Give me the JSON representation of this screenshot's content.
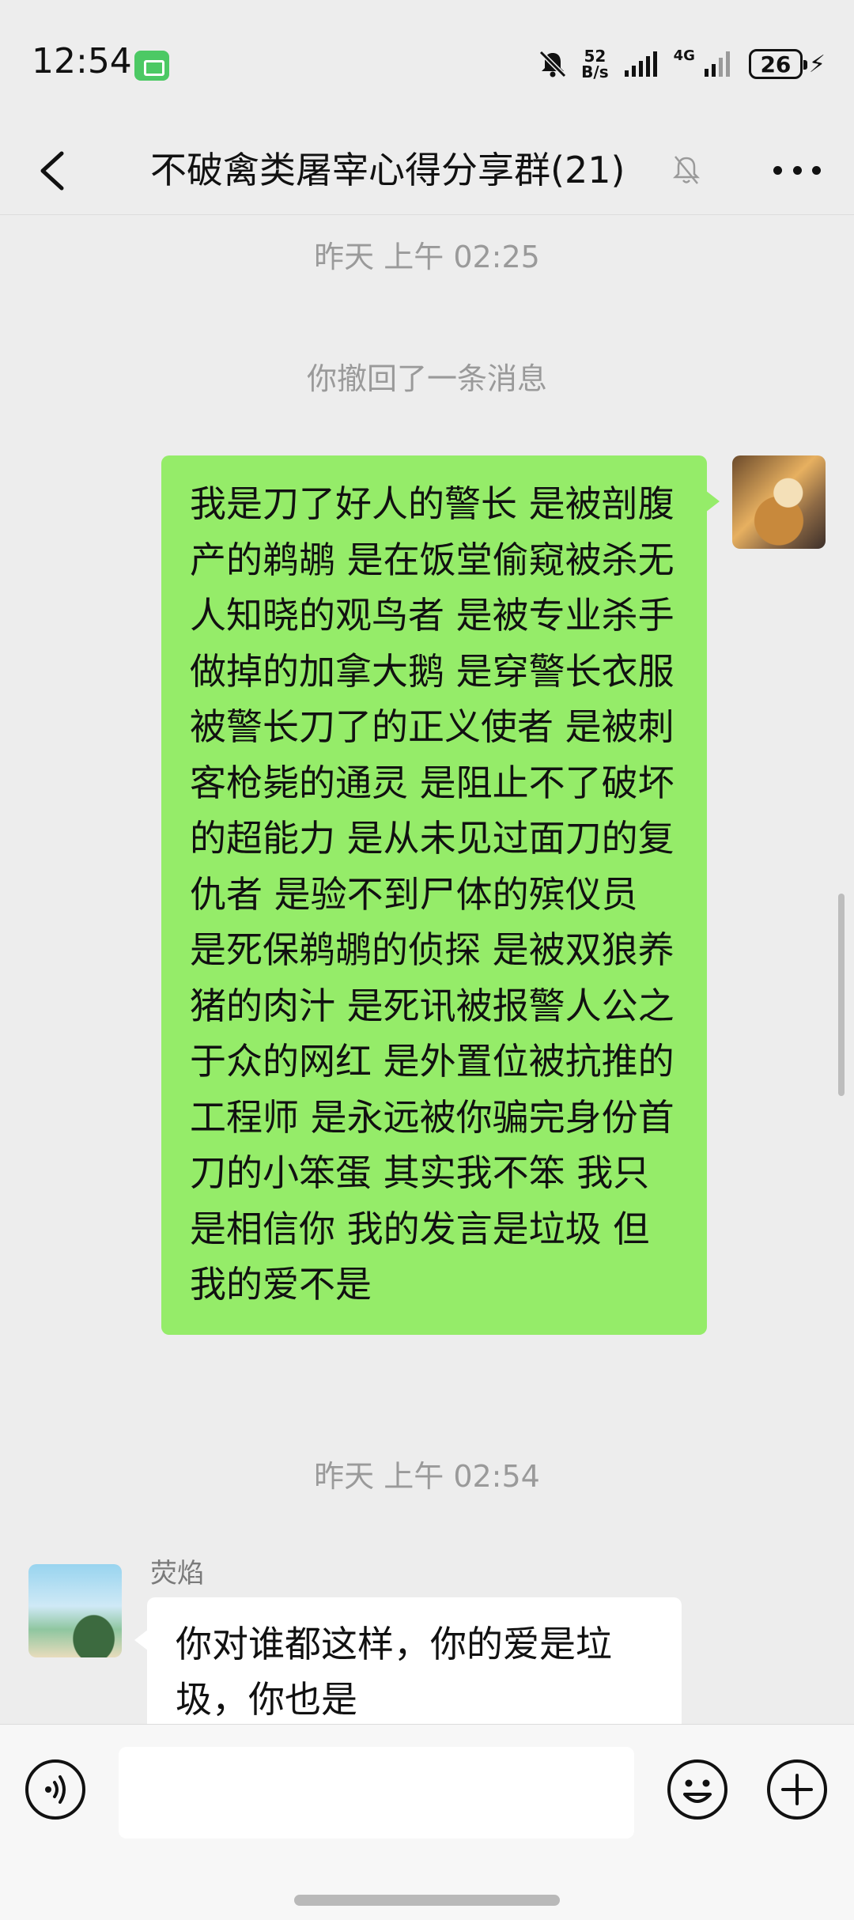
{
  "status_bar": {
    "time": "12:54",
    "net_speed_value": "52",
    "net_speed_unit": "B/s",
    "network_type": "4G",
    "battery": "26"
  },
  "header": {
    "title": "不破禽类屠宰心得分享群(21)"
  },
  "messages": {
    "timestamp_1": "昨天 上午 02:25",
    "recall_notice": "你撤回了一条消息",
    "self_message": "我是刀了好人的警长 是被剖腹产的鹈鹕 是在饭堂偷窥被杀无人知晓的观鸟者 是被专业杀手做掉的加拿大鹅 是穿警长衣服被警长刀了的正义使者 是被刺客枪毙的通灵 是阻止不了破坏的超能力 是从未见过面刀的复仇者 是验不到尸体的殡仪员 是死保鹈鹕的侦探 是被双狼养猪的肉汁 是死讯被报警人公之于众的网红 是外置位被抗推的工程师 是永远被你骗完身份首刀的小笨蛋 其实我不笨 我只是相信你 我的发言是垃圾 但我的爱不是",
    "timestamp_2": "昨天 上午 02:54",
    "other_sender": "荧焰",
    "other_message": "你对谁都这样，你的爱是垃圾，你也是"
  },
  "input_bar": {
    "placeholder": ""
  },
  "icons": {
    "back": "back-arrow-icon",
    "mute": "bell-muted-icon",
    "more": "more-dots-icon",
    "voice": "voice-icon",
    "emoji": "emoji-icon",
    "plus": "plus-icon"
  },
  "colors": {
    "background": "#ededed",
    "self_bubble": "#95ec69",
    "other_bubble": "#ffffff",
    "meta_text": "#9a9a9a"
  }
}
